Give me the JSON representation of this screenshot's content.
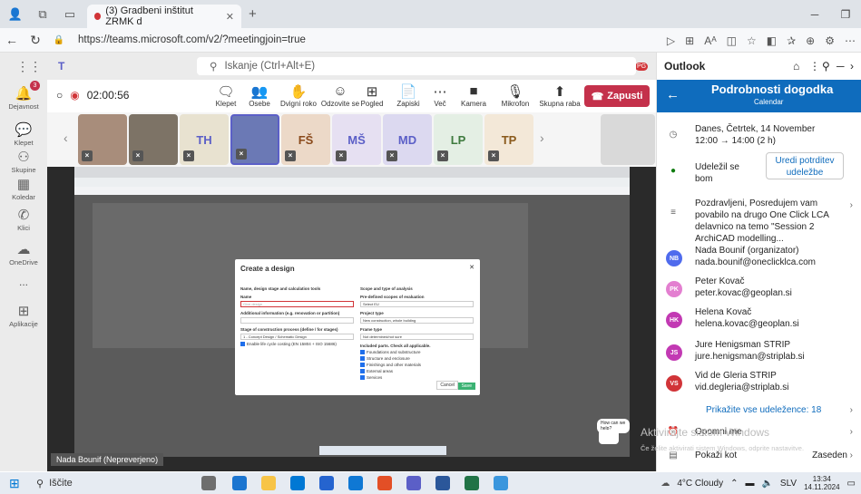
{
  "browser": {
    "tab_title": "(3) Gradbeni inštitut ZRMK d",
    "url": "https://teams.microsoft.com/v2/?meetingjoin=true",
    "profile_badge": "PG"
  },
  "teams": {
    "search_placeholder": "Iskanje (Ctrl+Alt+E)",
    "rail": [
      {
        "label": "Dejavnost",
        "icon": "bell-icon",
        "badge": "3"
      },
      {
        "label": "Klepet",
        "icon": "chat-icon"
      },
      {
        "label": "Skupine",
        "icon": "teams-icon"
      },
      {
        "label": "Koledar",
        "icon": "calendar-icon"
      },
      {
        "label": "Klici",
        "icon": "phone-icon"
      },
      {
        "label": "OneDrive",
        "icon": "cloud-icon"
      },
      {
        "label": "...",
        "icon": "more-icon"
      },
      {
        "label": "Aplikacije",
        "icon": "apps-icon"
      }
    ],
    "meeting": {
      "timer": "02:00:56",
      "controls": [
        {
          "label": "Klepet",
          "icon": "chat-icon"
        },
        {
          "label": "Osebe",
          "icon": "people-icon"
        },
        {
          "label": "Dvigni roko",
          "icon": "hand-icon"
        },
        {
          "label": "Odzovite se",
          "icon": "smile-icon"
        },
        {
          "label": "Pogled",
          "icon": "view-icon"
        },
        {
          "label": "Zapiski",
          "icon": "notes-icon"
        },
        {
          "label": "Več",
          "icon": "more-icon"
        },
        {
          "label": "Kamera",
          "icon": "camera-icon"
        },
        {
          "label": "Mikrofon",
          "icon": "mic-icon"
        },
        {
          "label": "Skupna raba",
          "icon": "share-icon"
        }
      ],
      "leave_label": "Zapusti",
      "participants": [
        "TH",
        "FŠ",
        "MŠ",
        "MD",
        "LP",
        "TP"
      ],
      "presenter": "Nada Bounif (Nepreverjeno)",
      "modal": {
        "title": "Create a design",
        "left_heading": "Name, design stage and calculation tools",
        "name_label": "Name",
        "name_placeholder": "Give design",
        "info_label": "Additional information (e.g. renovation or partition)",
        "stage_label": "Stage of construction process (define / for stages)",
        "stage_value": "1 - Concept Design / Schematic Design",
        "lifecycle": "Enable life cycle costing (EN 15804 + ISO 15686)",
        "right_heading": "Scope and type of analysis",
        "predefined_label": "Pre-defined scopes of evaluation",
        "predefined_value": "Select EU",
        "project_type_label": "Project type",
        "project_type_value": "New construction, whole building",
        "frame_label": "Frame type",
        "frame_value": "Not determined/not sure",
        "included_label": "Included parts. Check all applicable.",
        "included": [
          "Foundations and substructure",
          "Structure and enclosure",
          "Finishings and other materials",
          "External areas",
          "Services"
        ],
        "cancel": "Cancel",
        "save": "Save"
      },
      "help_bubble": "How can we help?"
    }
  },
  "outlook": {
    "app_title": "Outlook",
    "header_title": "Podrobnosti dogodka",
    "header_sub": "Calendar",
    "date": "Danes, Četrtek, 14 November",
    "time": "12:00 → 14:00 (2 h)",
    "attended": "Udeležil se bom",
    "edit_response": "Uredi potrditev udeležbe",
    "message": "Pozdravljeni, Posredujem vam povabilo na drugo One Click LCA delavnico na temo \"Session 2 ArchiCAD modelling...",
    "attendees": [
      {
        "initials": "NB",
        "name": "Nada Bounif (organizator)",
        "email": "nada.bounif@oneclicklca.com",
        "color": "#4f6bed"
      },
      {
        "initials": "PK",
        "name": "Peter Kovač",
        "email": "peter.kovac@geoplan.si",
        "color": "#e37fd0"
      },
      {
        "initials": "HK",
        "name": "Helena Kovač",
        "email": "helena.kovac@geoplan.si",
        "color": "#c239b3"
      },
      {
        "initials": "JS",
        "name": "Jure Henigsman STRIP",
        "email": "jure.henigsman@striplab.si",
        "color": "#c239b3"
      },
      {
        "initials": "VS",
        "name": "Vid de Gleria STRIP",
        "email": "vid.degleria@striplab.si",
        "color": "#d13438"
      }
    ],
    "show_all": "Prikažite vse udeležence: 18",
    "reminder": "Opomni me",
    "show_as_label": "Pokaži kot",
    "show_as_value": "Zaseden",
    "activate_windows": "Aktivirajte sistem Windows",
    "activate_windows_sub": "Če želite aktivirati sistem Windows, odprite nastavitve."
  },
  "taskbar": {
    "search": "Iščite",
    "weather": "4°C Cloudy",
    "lang": "SLV",
    "time": "13:34",
    "date": "14.11.2024"
  }
}
